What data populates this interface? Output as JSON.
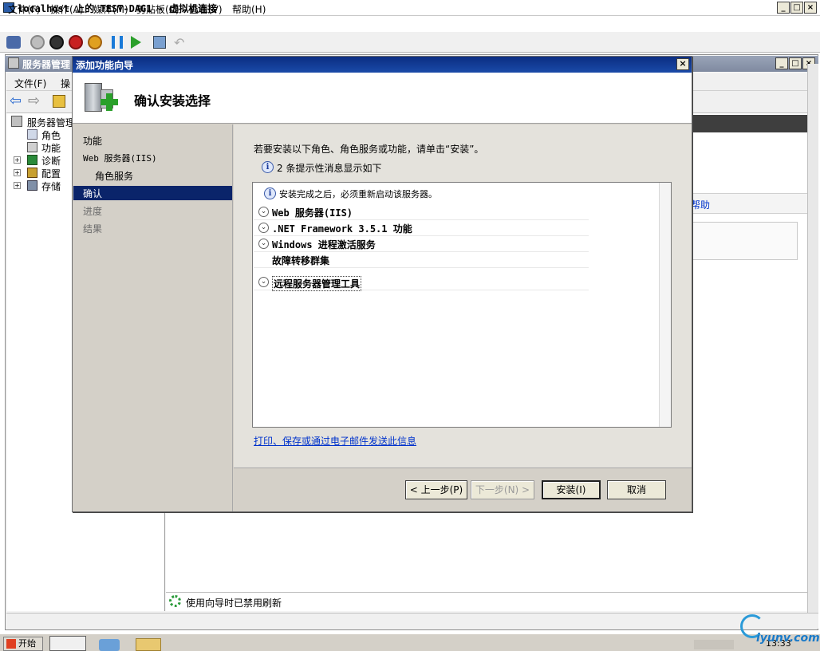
{
  "vm": {
    "title": "localhost 上的 TEST-DAG1 - 虚拟机连接",
    "menu": [
      "文件(F)",
      "操作(A)",
      "媒体(M)",
      "剪贴板(C)",
      "查看(V)",
      "帮助(H)"
    ]
  },
  "server_manager": {
    "title": "服务器管理",
    "menu": [
      "文件(F)",
      "操"
    ],
    "tree": {
      "root": "服务器管理",
      "items": [
        "角色",
        "功能",
        "诊断",
        "配置",
        "存储"
      ]
    },
    "help_link": "帮助",
    "status_text": "使用向导时已禁用刷新"
  },
  "wizard": {
    "title": "添加功能向导",
    "heading": "确认安装选择",
    "nav": {
      "items": [
        "功能",
        "Web 服务器(IIS)",
        "角色服务",
        "确认",
        "进度",
        "结果"
      ],
      "selected": "确认"
    },
    "instruction": "若要安装以下角色、角色服务或功能，请单击“安装”。",
    "message_count": "2 条提示性消息显示如下",
    "restart_notice": "安装完成之后，必须重新启动该服务器。",
    "items": [
      {
        "label": "Web 服务器(IIS)",
        "expandable": true
      },
      {
        "label": ".NET Framework 3.5.1 功能",
        "expandable": true
      },
      {
        "label": "Windows 进程激活服务",
        "expandable": true
      },
      {
        "label": "故障转移群集",
        "expandable": false
      },
      {
        "label": "远程服务器管理工具",
        "expandable": true
      }
    ],
    "print_link": "打印、保存或通过电子邮件发送此信息",
    "buttons": {
      "prev": "< 上一步(P)",
      "next": "下一步(N) >",
      "install": "安装(I)",
      "cancel": "取消"
    }
  },
  "taskbar": {
    "start_label": "开始",
    "clock": "13:33"
  },
  "watermark": "iyunv.com"
}
